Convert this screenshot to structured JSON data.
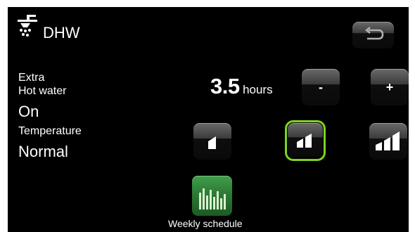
{
  "header": {
    "title": "DHW",
    "icon": "shower-icon",
    "back_icon": "back-arrow-icon"
  },
  "extra_hot_water": {
    "label_line1": "Extra",
    "label_line2": "Hot water",
    "status": "On"
  },
  "duration": {
    "value": "3.5",
    "unit": "hours",
    "decrease_label": "-",
    "increase_label": "+"
  },
  "temperature": {
    "label": "Temperature",
    "value": "Normal",
    "levels": [
      "low",
      "normal",
      "high"
    ],
    "selected_level": "normal"
  },
  "schedule": {
    "label": "Weekly schedule",
    "icon": "bar-chart-icon"
  },
  "colors": {
    "background": "#000000",
    "text": "#ffffff",
    "selected": "#7ed321",
    "schedule_button": "#2d7a34"
  }
}
